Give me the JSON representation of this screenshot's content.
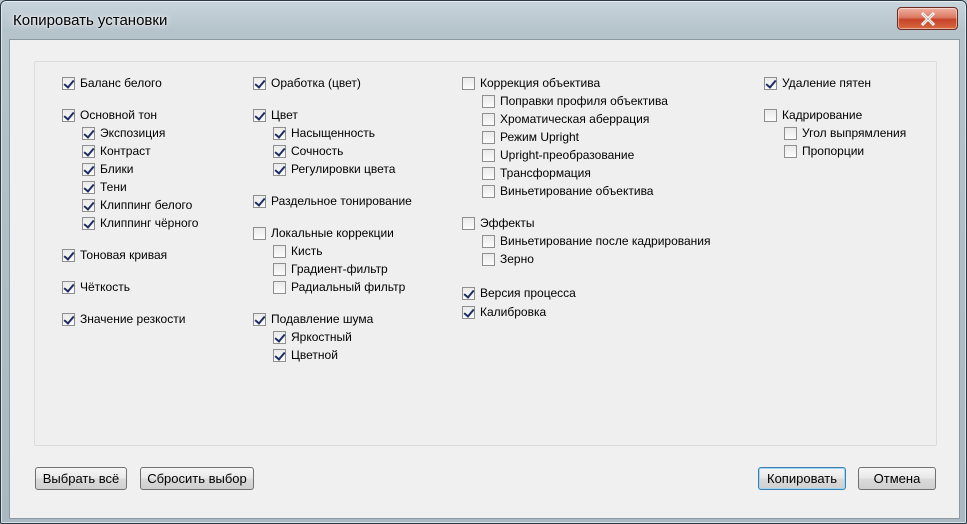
{
  "window": {
    "title": "Копировать установки"
  },
  "groups": {
    "col1": [
      {
        "label": "Баланс белого",
        "checked": true
      },
      {
        "label": "Основной тон",
        "checked": true
      },
      {
        "label": "Экспозиция",
        "checked": true
      },
      {
        "label": "Контраст",
        "checked": true
      },
      {
        "label": "Блики",
        "checked": true
      },
      {
        "label": "Тени",
        "checked": true
      },
      {
        "label": "Клиппинг белого",
        "checked": true
      },
      {
        "label": "Клиппинг чёрного",
        "checked": true
      },
      {
        "label": "Тоновая кривая",
        "checked": true
      },
      {
        "label": "Чёткость",
        "checked": true
      },
      {
        "label": "Значение резкости",
        "checked": true
      }
    ],
    "col2": [
      {
        "label": "Оработка (цвет)",
        "checked": true
      },
      {
        "label": "Цвет",
        "checked": true
      },
      {
        "label": "Насыщенность",
        "checked": true
      },
      {
        "label": "Сочность",
        "checked": true
      },
      {
        "label": "Регулировки цвета",
        "checked": true
      },
      {
        "label": "Раздельное тонирование",
        "checked": true
      },
      {
        "label": "Локальные коррекции",
        "checked": false
      },
      {
        "label": "Кисть",
        "checked": false
      },
      {
        "label": "Градиент-фильтр",
        "checked": false
      },
      {
        "label": "Радиальный фильтр",
        "checked": false
      },
      {
        "label": "Подавление шума",
        "checked": true
      },
      {
        "label": "Яркостный",
        "checked": true
      },
      {
        "label": "Цветной",
        "checked": true
      }
    ],
    "col3": [
      {
        "label": "Коррекция объектива",
        "checked": false
      },
      {
        "label": "Поправки профиля объектива",
        "checked": false
      },
      {
        "label": "Хроматическая аберрация",
        "checked": false
      },
      {
        "label": "Режим Upright",
        "checked": false
      },
      {
        "label": "Upright-преобразование",
        "checked": false
      },
      {
        "label": "Трансформация",
        "checked": false
      },
      {
        "label": "Виньетирование объектива",
        "checked": false
      },
      {
        "label": "Эффекты",
        "checked": false
      },
      {
        "label": "Виньетирование после кадрирования",
        "checked": false
      },
      {
        "label": "Зерно",
        "checked": false
      },
      {
        "label": "Версия процесса",
        "checked": true
      },
      {
        "label": "Калибровка",
        "checked": true
      }
    ],
    "col4": [
      {
        "label": "Удаление пятен",
        "checked": true
      },
      {
        "label": "Кадрирование",
        "checked": false
      },
      {
        "label": "Угол выпрямления",
        "checked": false
      },
      {
        "label": "Пропорции",
        "checked": false
      }
    ]
  },
  "buttons": {
    "select_all": "Выбрать всё",
    "reset": "Сбросить выбор",
    "copy": "Копировать",
    "cancel": "Отмена"
  }
}
